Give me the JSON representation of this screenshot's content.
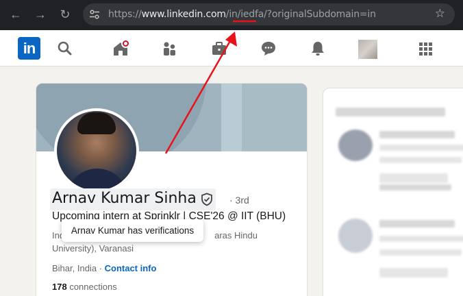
{
  "browser": {
    "url_scheme": "https://",
    "url_host": "www.linkedin.com",
    "url_path_1": "/in/",
    "url_handle": "iedfa",
    "url_path_2": "/?originalSubdomain=in"
  },
  "nav": {
    "logo_text": "in"
  },
  "profile": {
    "name": "Arnav Kumar Sinha",
    "degree": "· 3rd",
    "headline": "Upcoming intern at Sprinklr | CSE'26 @ IIT (BHU)",
    "education_line1": "Ind",
    "education_line1_right": "aras Hindu",
    "education_line2": "University), Varanasi",
    "location": "Bihar, India · ",
    "contact_info": "Contact info",
    "connections_count": "178",
    "connections_label": " connections"
  },
  "tooltip": {
    "text": "Arnav Kumar has verifications"
  },
  "colors": {
    "linkedin_blue": "#0a66c2",
    "annotation_red": "#e8131a",
    "notification_red": "#cb112d"
  }
}
